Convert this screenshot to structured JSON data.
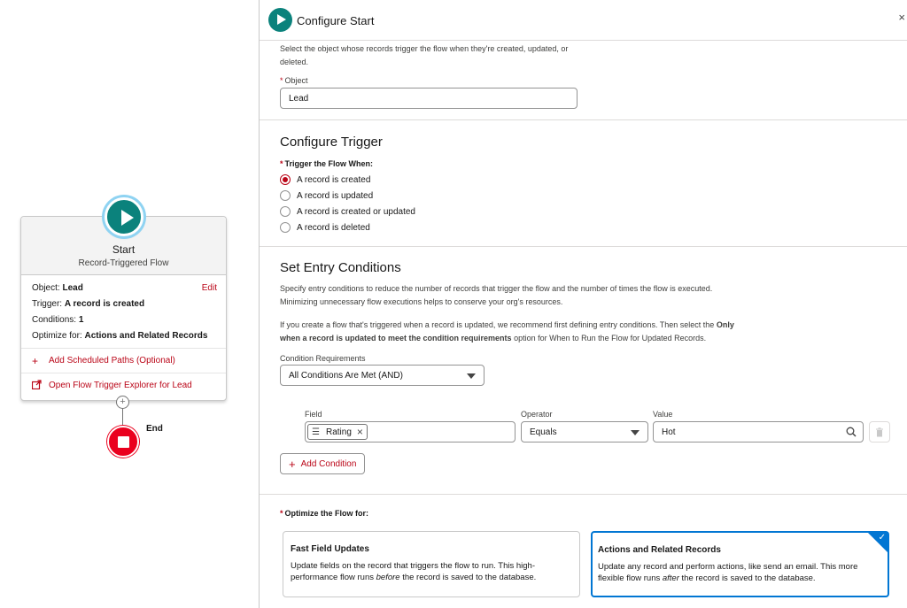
{
  "canvas": {
    "start": {
      "title": "Start",
      "subtitle": "Record-Triggered Flow",
      "edit_label": "Edit",
      "object_label": "Object:",
      "object_value": "Lead",
      "trigger_label": "Trigger:",
      "trigger_value": "A record is created",
      "conditions_label": "Conditions:",
      "conditions_value": "1",
      "optimize_label": "Optimize for:",
      "optimize_value": "Actions and Related Records",
      "add_scheduled_paths": "Add Scheduled Paths (Optional)",
      "open_explorer": "Open Flow Trigger Explorer for Lead"
    },
    "add_icon": "+",
    "end_label": "End"
  },
  "panel": {
    "title": "Configure Start",
    "close_icon": "×",
    "object_section": {
      "description": "Select the object whose records trigger the flow when they're created, updated, or deleted.",
      "object_label": "Object",
      "object_value": "Lead"
    },
    "trigger_section": {
      "title": "Configure Trigger",
      "label": "Trigger the Flow When:",
      "options": [
        {
          "label": "A record is created",
          "selected": true
        },
        {
          "label": "A record is updated",
          "selected": false
        },
        {
          "label": "A record is created or updated",
          "selected": false
        },
        {
          "label": "A record is deleted",
          "selected": false
        }
      ]
    },
    "entry_section": {
      "title": "Set Entry Conditions",
      "desc1": "Specify entry conditions to reduce the number of records that trigger the flow and the number of times the flow is executed. Minimizing unnecessary flow executions helps to conserve your org's resources.",
      "desc2_pre": "If you create a flow that's triggered when a record is updated, we recommend first defining entry conditions. Then select the",
      "desc2_bold": "Only when a record is updated to meet the condition requirements",
      "desc2_post": "option for When to Run the Flow for Updated Records.",
      "requirements_label": "Condition Requirements",
      "requirements_value": "All Conditions Are Met (AND)",
      "field_col": "Field",
      "operator_col": "Operator",
      "value_col": "Value",
      "field_value": "Rating",
      "operator_value": "Equals",
      "value_value": "Hot",
      "add_condition": "Add Condition"
    },
    "optimize_section": {
      "label": "Optimize the Flow for:",
      "fast": {
        "title": "Fast Field Updates",
        "desc_pre": "Update fields on the record that triggers the flow to run. This high-performance flow runs",
        "desc_em": "before",
        "desc_post": "the record is saved to the database."
      },
      "actions": {
        "title": "Actions and Related Records",
        "desc_pre": "Update any record and perform actions, like send an email. This more flexible flow runs",
        "desc_em": "after",
        "desc_post": "the record is saved to the database.",
        "selected": true
      }
    }
  },
  "colors": {
    "accent": "#0b827c",
    "link": "#ba0517",
    "selected_border": "#0176d3",
    "end_node": "#ea001e"
  }
}
